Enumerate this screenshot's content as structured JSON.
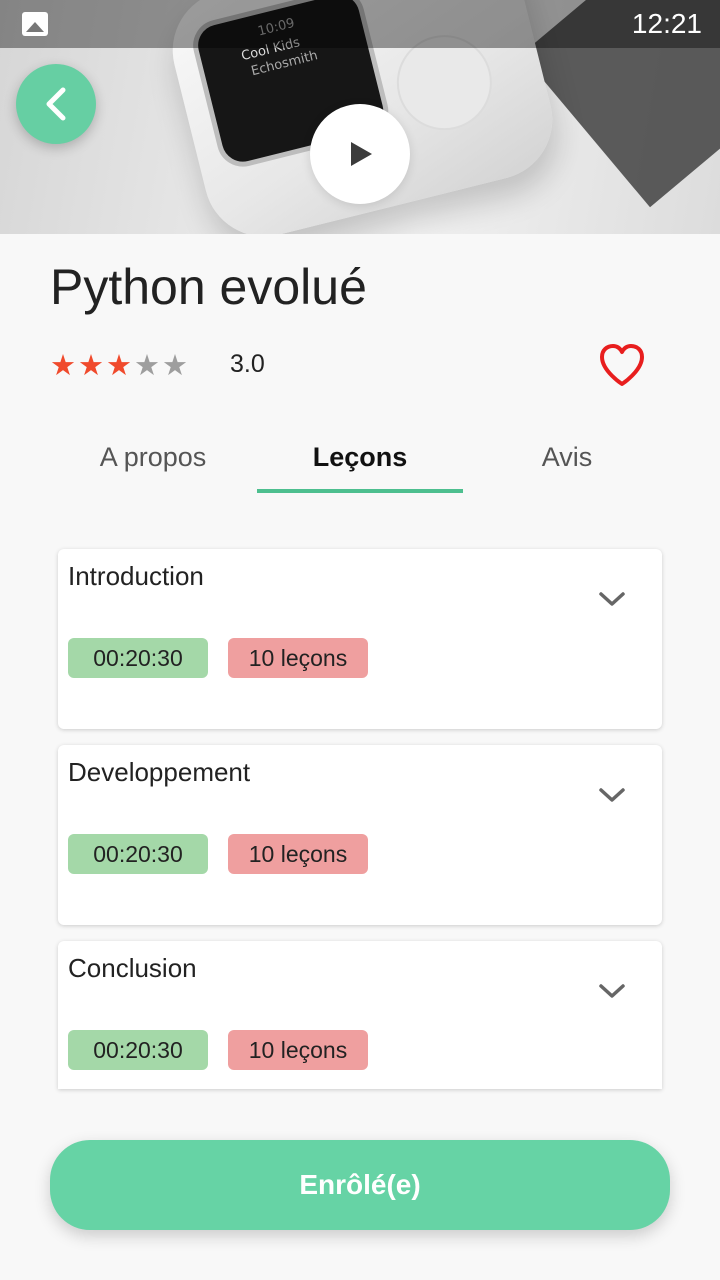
{
  "status_bar": {
    "time": "12:21"
  },
  "hero": {
    "device_screen": {
      "line1": "Cool Kids",
      "line2": "Echosmith",
      "time": "10:09"
    }
  },
  "course": {
    "title": "Python evolué",
    "rating": 3.0,
    "rating_text": "3.0",
    "rating_max": 5,
    "favorite_color": "#e81e1e"
  },
  "tabs": [
    {
      "label": "A propos",
      "active": false
    },
    {
      "label": "Leçons",
      "active": true
    },
    {
      "label": "Avis",
      "active": false
    }
  ],
  "sections": [
    {
      "title": "Introduction",
      "duration": "00:20:30",
      "lessons": "10 leçons"
    },
    {
      "title": "Developpement",
      "duration": "00:20:30",
      "lessons": "10 leçons"
    },
    {
      "title": "Conclusion",
      "duration": "00:20:30",
      "lessons": "10 leçons"
    }
  ],
  "enroll_button": {
    "label": "Enrôlé(e)"
  },
  "colors": {
    "accent": "#66d3a5",
    "star_on": "#f04a2c",
    "star_off": "#9e9e9e",
    "duration_badge": "#a4d8a8",
    "lessons_badge": "#ef9f9f"
  },
  "icons": {
    "back": "chevron-left-icon",
    "play": "play-icon",
    "favorite": "heart-outline-icon",
    "expand": "chevron-down-icon",
    "status_image": "image-icon"
  }
}
